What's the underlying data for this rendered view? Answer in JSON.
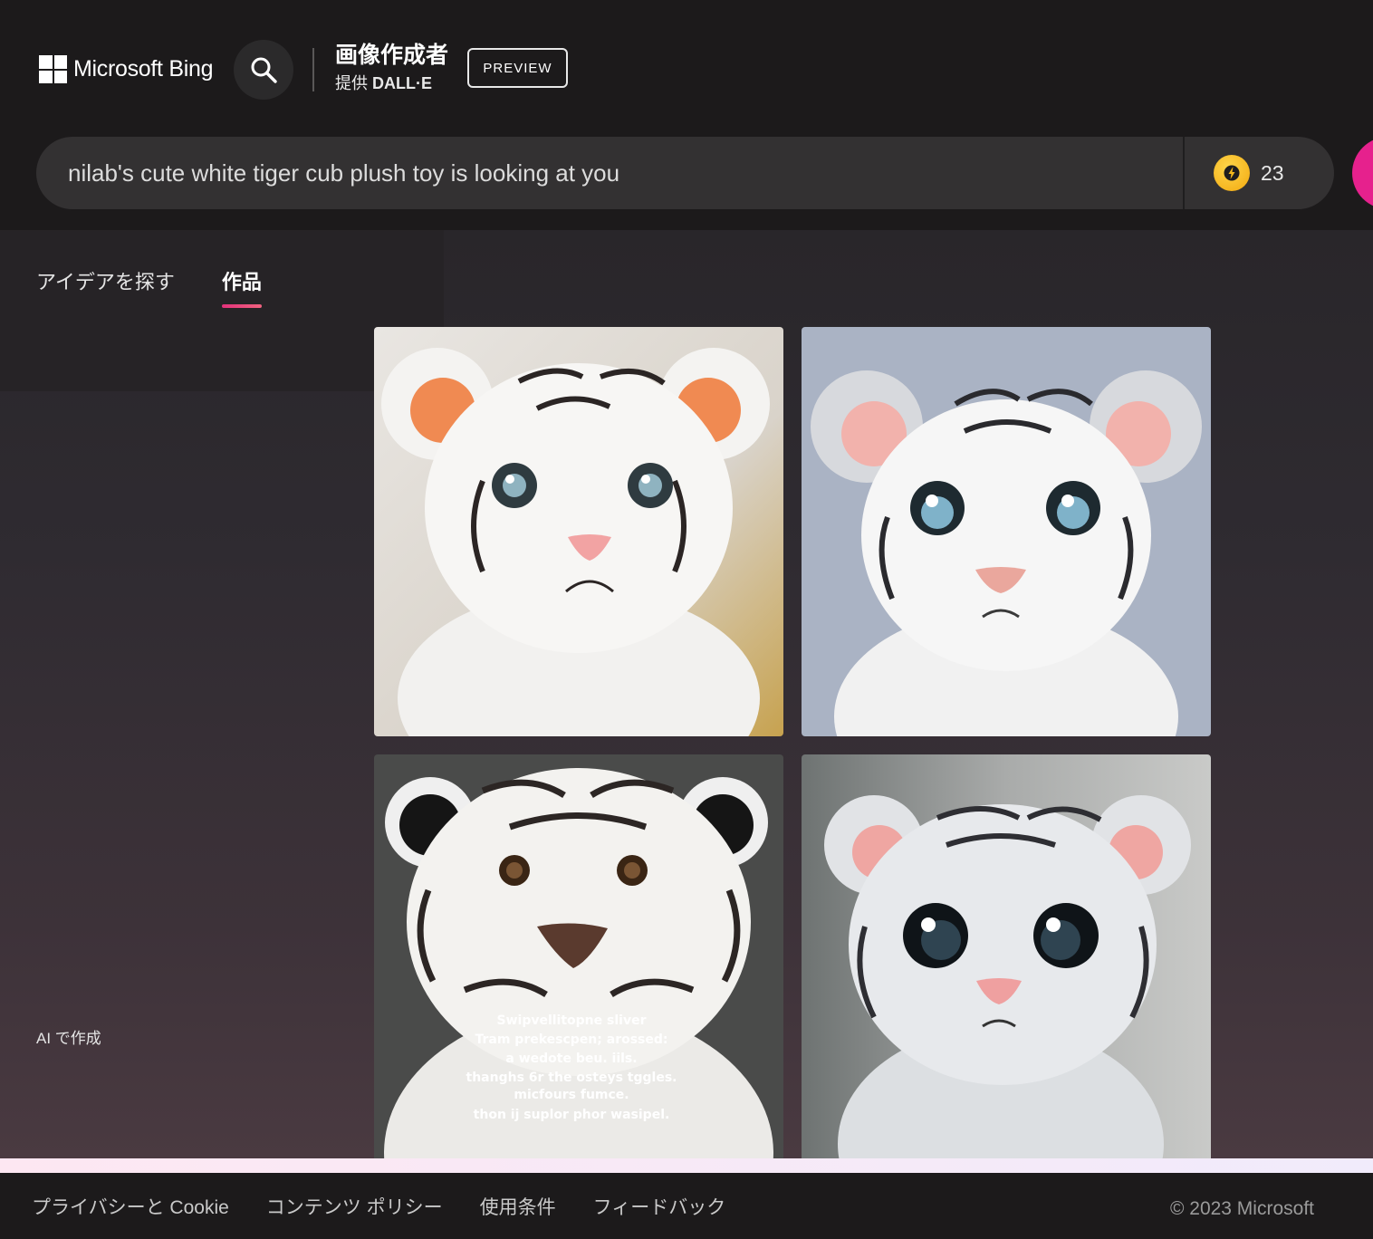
{
  "header": {
    "brand": "Microsoft Bing",
    "app_title": "画像作成者",
    "provider_prefix": "提供",
    "provider_name": "DALL·E",
    "badge": "PREVIEW"
  },
  "prompt": {
    "value": "nilab's cute white tiger cub plush toy is looking at you",
    "boosts": "23"
  },
  "tabs": [
    {
      "label": "アイデアを探す",
      "active": false
    },
    {
      "label": "作品",
      "active": true
    }
  ],
  "sidebar_label": "AI で作成",
  "image_grid": [
    {
      "alt": "white tiger cub plush, blue eyes, orange ears, soft background"
    },
    {
      "alt": "white tiger cub plush, big blue eyes, pink ears, grey-blue background"
    },
    {
      "alt": "white tiger cub plush, black ears, brown eyes, garbled caption text"
    },
    {
      "alt": "white tiger cub plush, large dark eyes, pink ears, grey background"
    }
  ],
  "image3_caption": [
    "Swipvellitopne sliver",
    "Tram prekescpen; arossed:",
    "a wedote beu. iils.",
    "thanghs 6r the osteys tggles.",
    "micfours fumce.",
    "thon ij suplor phor wasipel."
  ],
  "footer": {
    "links": [
      "プライバシーと Cookie",
      "コンテンツ ポリシー",
      "使用条件",
      "フィードバック"
    ],
    "copyright": "© 2023 Microsoft"
  },
  "colors": {
    "accent": "#e6218d",
    "coin": "#f5b81c",
    "header_bg": "#1c1a1b",
    "prompt_bg": "#333132"
  }
}
